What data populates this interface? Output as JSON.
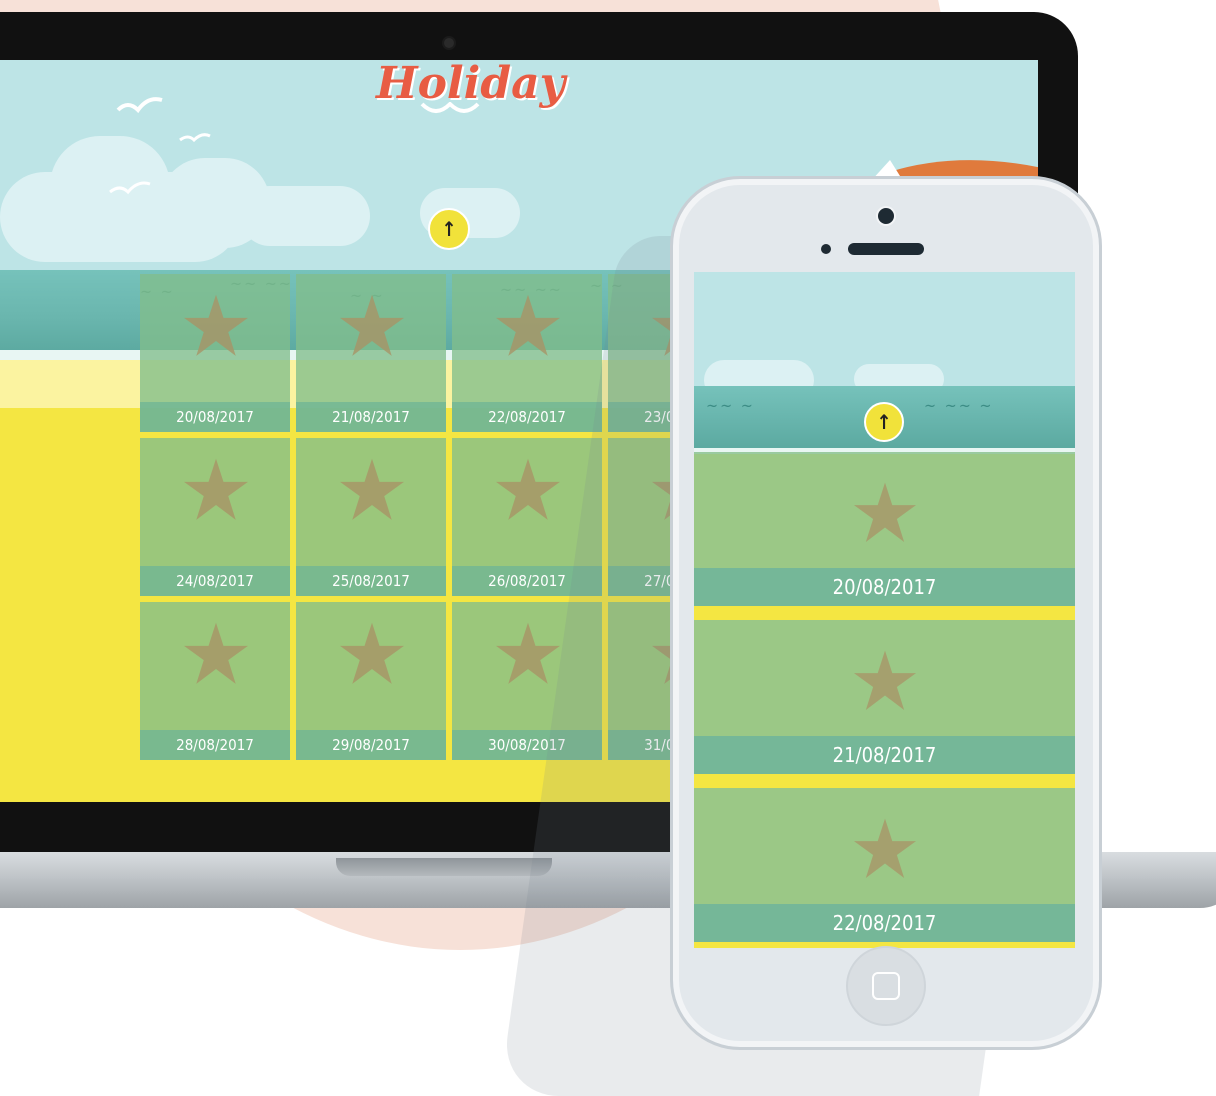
{
  "laptop": {
    "logo_text": "Holiday",
    "tiles": [
      {
        "date": "20/08/2017"
      },
      {
        "date": "21/08/2017"
      },
      {
        "date": "22/08/2017"
      },
      {
        "date": "23/08/2017"
      },
      {
        "date": "24/08/2017"
      },
      {
        "date": "25/08/2017"
      },
      {
        "date": "26/08/2017"
      },
      {
        "date": "27/08/2017"
      },
      {
        "date": "28/08/2017"
      },
      {
        "date": "29/08/2017"
      },
      {
        "date": "30/08/2017"
      },
      {
        "date": "31/08/2017"
      }
    ],
    "scroll_top_icon": "arrow-up-icon"
  },
  "phone": {
    "tiles": [
      {
        "date": "20/08/2017"
      },
      {
        "date": "21/08/2017"
      },
      {
        "date": "22/08/2017"
      }
    ],
    "scroll_top_icon": "arrow-up-icon"
  },
  "colors": {
    "sky": "#bde4e6",
    "sea": "#6ab6ae",
    "sand": "#f4e642",
    "tile": "#82be8c",
    "logo": "#e85c43",
    "button": "#f1e23a"
  }
}
